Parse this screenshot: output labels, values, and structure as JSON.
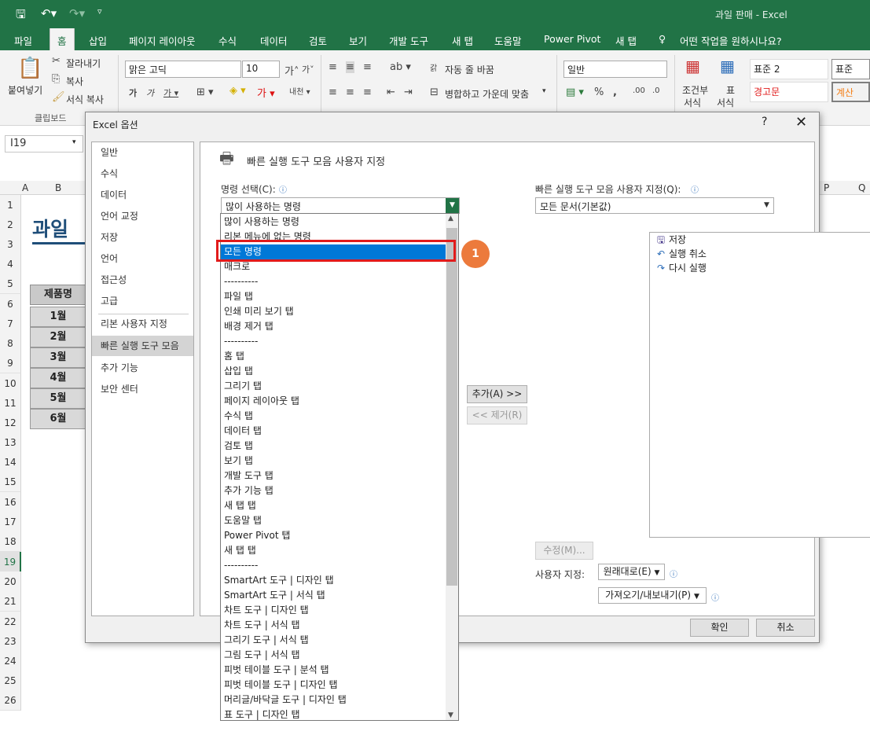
{
  "app": {
    "window_title": "과일 판매  -  Excel"
  },
  "tabs": [
    "파일",
    "홈",
    "삽입",
    "페이지 레이아웃",
    "수식",
    "데이터",
    "검토",
    "보기",
    "개발 도구",
    "새 탭",
    "도움말",
    "Power Pivot",
    "새 탭",
    "어떤 작업을 원하시나요?"
  ],
  "ribbon": {
    "paste": "붙여넣기",
    "cut": "잘라내기",
    "copy": "복사",
    "format_painter": "서식 복사",
    "clipboard_group": "클립보드",
    "font_name": "맑은 고딕",
    "font_size": "10",
    "wrap_text": "자동 줄 바꿈",
    "merge_center": "병합하고 가운데 맞춤",
    "number_format": "일반",
    "cond_format_l1": "조건부",
    "cond_format_l2": "서식",
    "table_format_l1": "표",
    "table_format_l2": "서식",
    "style_normal2": "표준 2",
    "style_normal": "표준",
    "style_warning": "경고문",
    "style_calc": "계산"
  },
  "sheet": {
    "name_box": "I19",
    "col_headers": [
      "A",
      "B",
      "P",
      "Q"
    ],
    "row_numbers": [
      "1",
      "2",
      "3",
      "4",
      "5",
      "6",
      "7",
      "8",
      "9",
      "10",
      "11",
      "12",
      "13",
      "14",
      "15",
      "16",
      "17",
      "18",
      "19",
      "20",
      "21",
      "22",
      "23",
      "24",
      "25",
      "26"
    ],
    "title_partial": "과일",
    "header_cell": "제품명",
    "months": [
      "1월",
      "2월",
      "3월",
      "4월",
      "5월",
      "6월"
    ]
  },
  "dialog": {
    "title": "Excel 옵션",
    "help": "?",
    "close": "✕",
    "nav": [
      "일반",
      "수식",
      "데이터",
      "언어 교정",
      "저장",
      "언어",
      "접근성",
      "고급",
      "리본 사용자 지정",
      "빠른 실행 도구 모음",
      "추가 기능",
      "보안 센터"
    ],
    "heading": "빠른 실행 도구 모음 사용자 지정",
    "choose_label": "명령 선택(C):",
    "choose_value": "많이 사용하는 명령",
    "customize_label": "빠른 실행 도구 모음 사용자 지정(Q):",
    "customize_value": "모든 문서(기본값)",
    "add_button": "추가(A) >>",
    "remove_button": "<< 제거(R)",
    "modify_button": "수정(M)...",
    "customizations_label": "사용자 지정:",
    "reset_button": "원래대로(E)",
    "import_export_button": "가져오기/내보내기(P)",
    "ok_button": "확인",
    "cancel_button": "취소",
    "qat_items": [
      {
        "icon": "save-icon",
        "label": "저장",
        "submenu": false
      },
      {
        "icon": "undo-icon",
        "label": "실행 취소",
        "submenu": true
      },
      {
        "icon": "redo-icon",
        "label": "다시 실행",
        "submenu": true
      }
    ]
  },
  "dropdown": {
    "selected_index": 2,
    "items": [
      "많이 사용하는 명령",
      "리본 메뉴에 없는 명령",
      "모든 명령",
      "매크로",
      "----------",
      "파일 탭",
      "인쇄 미리 보기 탭",
      "배경 제거 탭",
      "----------",
      "홈 탭",
      "삽입 탭",
      "그리기 탭",
      "페이지 레이아웃 탭",
      "수식 탭",
      "데이터 탭",
      "검토 탭",
      "보기 탭",
      "개발 도구 탭",
      "추가 기능 탭",
      "새 탭 탭",
      "도움말 탭",
      "Power Pivot 탭",
      "새 탭 탭",
      "----------",
      "SmartArt 도구 | 디자인 탭",
      "SmartArt 도구 | 서식 탭",
      "차트 도구 | 디자인 탭",
      "차트 도구 | 서식 탭",
      "그리기 도구 | 서식 탭",
      "그림 도구 | 서식 탭",
      "피벗 테이블 도구 | 분석 탭",
      "피벗 테이블 도구 | 디자인 탭",
      "머리글/바닥글 도구 | 디자인 탭",
      "표 도구 | 디자인 탭"
    ]
  },
  "callout": {
    "number": "1"
  },
  "colors": {
    "excel_green": "#217346",
    "highlight_blue": "#0078d7",
    "callout_orange": "#ec7a3c",
    "marker_red": "#e11b1b"
  }
}
